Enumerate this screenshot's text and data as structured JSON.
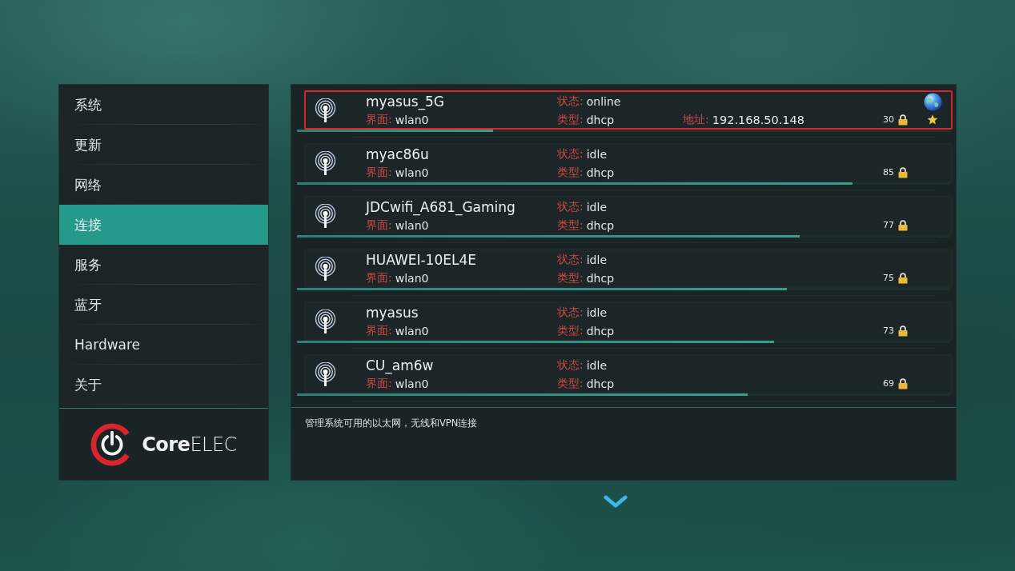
{
  "sidebar": {
    "items": [
      {
        "label": "系统",
        "selected": false
      },
      {
        "label": "更新",
        "selected": false
      },
      {
        "label": "网络",
        "selected": false
      },
      {
        "label": "连接",
        "selected": true
      },
      {
        "label": "服务",
        "selected": false
      },
      {
        "label": "蓝牙",
        "selected": false
      },
      {
        "label": "Hardware",
        "selected": false
      },
      {
        "label": "关于",
        "selected": false
      }
    ],
    "logo": {
      "text": "**Core**ELEC"
    }
  },
  "networks": [
    {
      "name": "myasus_5G",
      "interface": {
        "label": "界面:",
        "value": "wlan0"
      },
      "state": {
        "label": "状态:",
        "value": "online"
      },
      "type": {
        "label": "类型:",
        "value": "dhcp"
      },
      "address": {
        "label": "地址:",
        "value": "192.168.50.148"
      },
      "strength": "30",
      "level": 0.3,
      "secured": true,
      "connected": true,
      "favorite": true,
      "selected": true
    },
    {
      "name": "myac86u",
      "interface": {
        "label": "界面:",
        "value": "wlan0"
      },
      "state": {
        "label": "状态:",
        "value": "idle"
      },
      "type": {
        "label": "类型:",
        "value": "dhcp"
      },
      "strength": "85",
      "level": 0.85,
      "secured": true,
      "connected": false,
      "favorite": false,
      "selected": false
    },
    {
      "name": "JDCwifi_A681_Gaming",
      "interface": {
        "label": "界面:",
        "value": "wlan0"
      },
      "state": {
        "label": "状态:",
        "value": "idle"
      },
      "type": {
        "label": "类型:",
        "value": "dhcp"
      },
      "strength": "77",
      "level": 0.77,
      "secured": true,
      "connected": false,
      "favorite": false,
      "selected": false
    },
    {
      "name": "HUAWEI-10EL4E",
      "interface": {
        "label": "界面:",
        "value": "wlan0"
      },
      "state": {
        "label": "状态:",
        "value": "idle"
      },
      "type": {
        "label": "类型:",
        "value": "dhcp"
      },
      "strength": "75",
      "level": 0.75,
      "secured": true,
      "connected": false,
      "favorite": false,
      "selected": false
    },
    {
      "name": "myasus",
      "interface": {
        "label": "界面:",
        "value": "wlan0"
      },
      "state": {
        "label": "状态:",
        "value": "idle"
      },
      "type": {
        "label": "类型:",
        "value": "dhcp"
      },
      "strength": "73",
      "level": 0.73,
      "secured": true,
      "connected": false,
      "favorite": false,
      "selected": false
    },
    {
      "name": "CU_am6w",
      "interface": {
        "label": "界面:",
        "value": "wlan0"
      },
      "state": {
        "label": "状态:",
        "value": "idle"
      },
      "type": {
        "label": "类型:",
        "value": "dhcp"
      },
      "strength": "69",
      "level": 0.69,
      "secured": true,
      "connected": false,
      "favorite": false,
      "selected": false
    }
  ],
  "description": "管理系统可用的以太网，无线和VPN连接"
}
